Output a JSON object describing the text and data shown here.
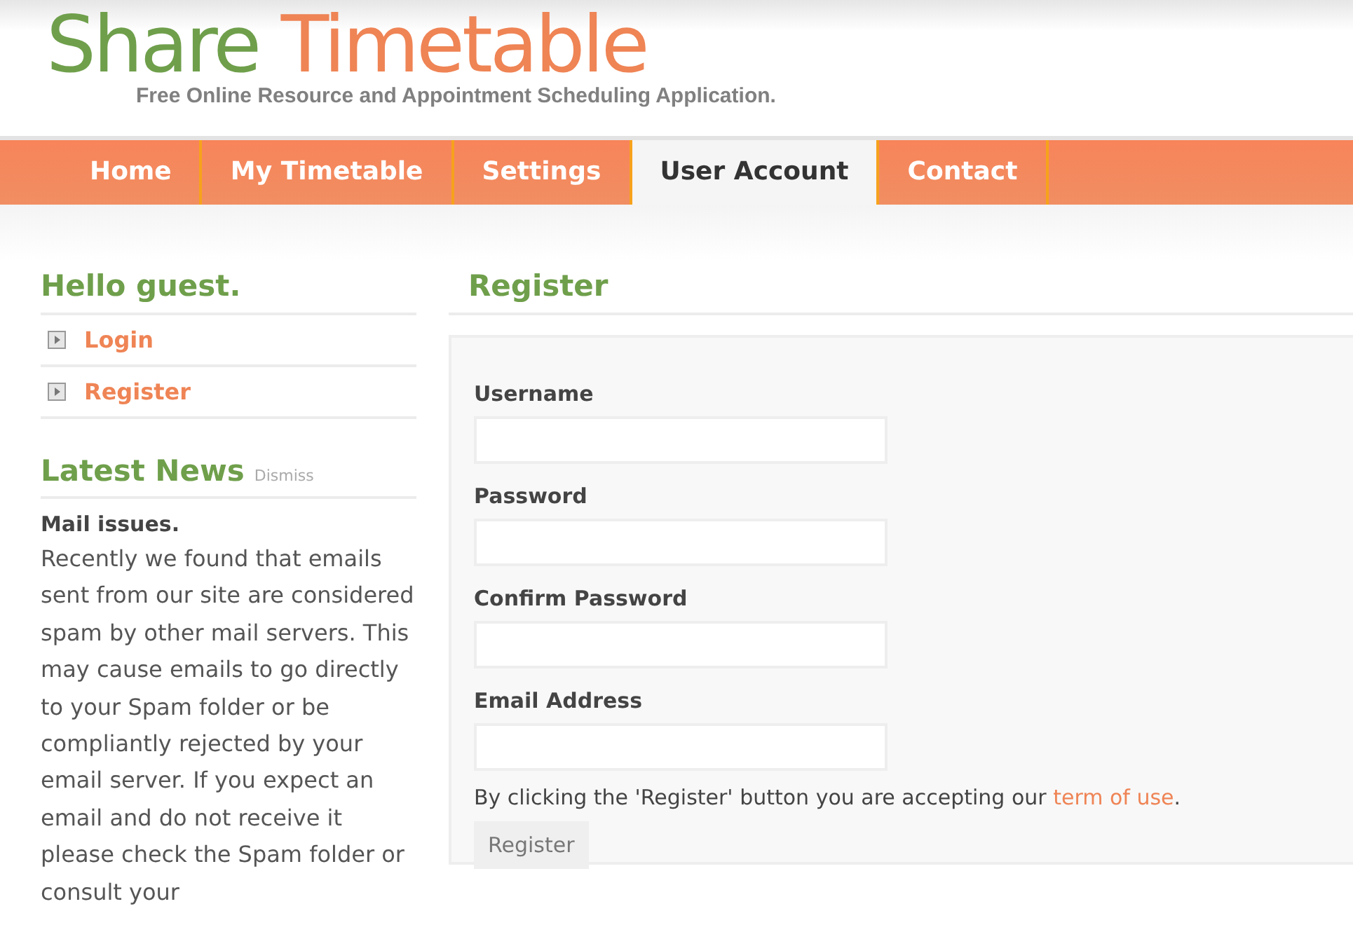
{
  "logo": {
    "first": "Share",
    "second": "Timetable",
    "tagline": "Free Online Resource and Appointment Scheduling Application."
  },
  "tabs": [
    {
      "label": "Home",
      "selected": false
    },
    {
      "label": "My Timetable",
      "selected": false
    },
    {
      "label": "Settings",
      "selected": false
    },
    {
      "label": "User Account",
      "selected": true
    },
    {
      "label": "Contact",
      "selected": false
    }
  ],
  "sidebar": {
    "greeting": "Hello guest.",
    "links": [
      {
        "label": "Login"
      },
      {
        "label": "Register"
      }
    ],
    "news": {
      "title": "Latest News",
      "dismiss": "Dismiss",
      "headline": "Mail issues.",
      "body": "Recently we found that emails sent from our site are considered spam by other mail servers. This may cause emails to go directly to your Spam folder or be compliantly rejected by your email server. If you expect an email and do not receive it please check the Spam folder or consult your"
    }
  },
  "form": {
    "title": "Register",
    "fields": [
      {
        "label": "Username"
      },
      {
        "label": "Password"
      },
      {
        "label": "Confirm Password"
      },
      {
        "label": "Email Address"
      }
    ],
    "notice": {
      "before": "By clicking the 'Register' button you are accepting our ",
      "link": "term of use",
      "after": "."
    },
    "button": "Register"
  }
}
